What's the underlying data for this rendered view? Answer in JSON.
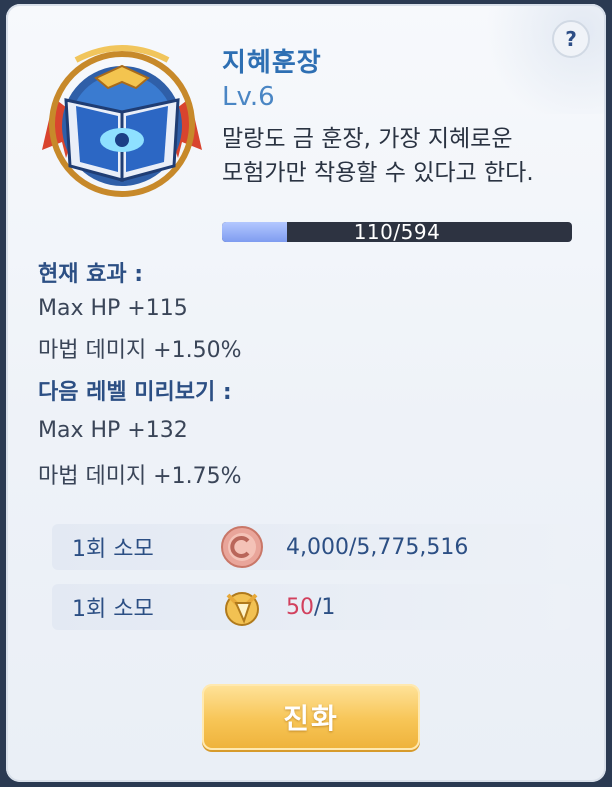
{
  "item": {
    "name": "지혜훈장",
    "level": "Lv.6",
    "description_line1": "말랑도 금 훈장, 가장 지혜로운",
    "description_line2": "모험가만 착용할 수 있다고 한다.",
    "progress_text": "110/594",
    "progress_fraction": 0.185
  },
  "current_effect": {
    "heading": "현재 효과 :",
    "stat1": "Max HP +115",
    "stat2": "마법 데미지 +1.50%"
  },
  "next_level": {
    "heading": "다음 레벨 미리보기 :",
    "stat1": "Max HP +132",
    "stat2": "마법 데미지 +1.75%"
  },
  "costs": [
    {
      "label": "1회 소모",
      "icon": "coin-icon",
      "value": "4,000/5,775,516"
    },
    {
      "label": "1회 소모",
      "icon": "gold-medal-icon",
      "value_red": "50",
      "value_rest": "/1"
    }
  ],
  "buttons": {
    "evolve": "진화",
    "help": "?"
  },
  "colors": {
    "accent": "#2e6fb3",
    "button": "#f7c556",
    "warning": "#d2405d"
  }
}
